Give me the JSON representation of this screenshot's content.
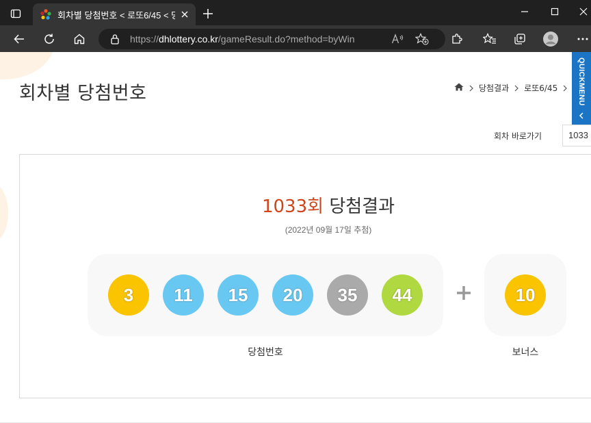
{
  "browser": {
    "tab_title": "회차별 당첨번호 < 로또6/45 < 당",
    "url_prefix": "https://",
    "url_host": "dhlottery.co.kr",
    "url_path": "/gameResult.do?method=byWin"
  },
  "page": {
    "title": "회차별 당첨번호",
    "breadcrumb": [
      "당첨결과",
      "로또6/45"
    ],
    "quickmenu_label": "QUICKMENU",
    "goto_label": "회차 바로가기",
    "goto_value": "1033"
  },
  "result": {
    "round_number": "1033회",
    "round_suffix": "당첨결과",
    "draw_date": "(2022년 09월 17일 추첨)",
    "winning_numbers": [
      {
        "value": "3",
        "color": "#fbc400"
      },
      {
        "value": "11",
        "color": "#69c8f2"
      },
      {
        "value": "15",
        "color": "#69c8f2"
      },
      {
        "value": "20",
        "color": "#69c8f2"
      },
      {
        "value": "35",
        "color": "#aaaaaa"
      },
      {
        "value": "44",
        "color": "#b0d840"
      }
    ],
    "bonus_number": {
      "value": "10",
      "color": "#fbc400"
    },
    "winning_label": "당첨번호",
    "bonus_label": "보너스"
  }
}
